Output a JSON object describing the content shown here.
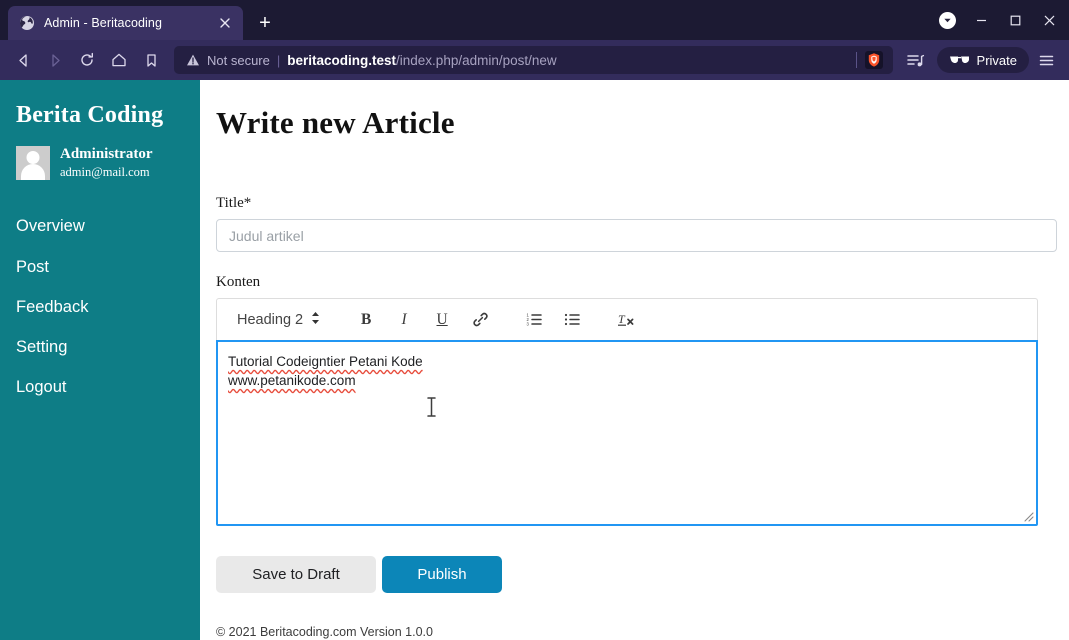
{
  "browser": {
    "tab": {
      "title": "Admin - Beritacoding",
      "favicon_icon": "globe-icon",
      "close_icon": "close-icon"
    },
    "new_tab_label": "+",
    "window_controls": {
      "brave_rewards_icon": "chevron-down-badge-icon",
      "minimize_label": "–",
      "maximize_label": "☐",
      "close_label": "×"
    },
    "nav": {
      "back_icon": "back-arrow-icon",
      "forward_icon": "forward-arrow-icon",
      "reload_icon": "reload-icon",
      "home_icon": "home-icon",
      "bookmark_icon": "bookmark-icon"
    },
    "address_bar": {
      "security_icon": "warning-triangle-icon",
      "security_label": "Not secure",
      "separator": "|",
      "url_host": "beritacoding.test",
      "url_path": "/index.php/admin/post/new",
      "shield_icon": "brave-shield-icon",
      "playlist_icon": "playlist-icon",
      "private_icon": "sunglasses-icon",
      "private_label": "Private",
      "menu_icon": "hamburger-menu-icon"
    },
    "colors": {
      "tabstrip_bg": "#1c1a33",
      "tab_active_bg": "#3a3263",
      "navbar_bg": "#332c5c",
      "urlbar_bg": "#241f42",
      "brave_orange": "#fb542b"
    }
  },
  "sidebar": {
    "brand": "Berita Coding",
    "user": {
      "avatar_icon": "user-avatar-icon",
      "name": "Administrator",
      "email": "admin@mail.com"
    },
    "items": [
      {
        "label": "Overview"
      },
      {
        "label": "Post"
      },
      {
        "label": "Feedback"
      },
      {
        "label": "Setting"
      },
      {
        "label": "Logout"
      }
    ],
    "bg_color": "#0e7d86"
  },
  "main": {
    "page_title": "Write new Article",
    "title_field": {
      "label": "Title*",
      "value": "",
      "placeholder": "Judul artikel"
    },
    "content_field": {
      "label": "Konten",
      "toolbar": {
        "heading_select": {
          "value": "Heading 2",
          "selector_icon": "updown-arrows-icon"
        },
        "buttons": [
          {
            "label": "B",
            "name": "bold-button"
          },
          {
            "label": "I",
            "name": "italic-button"
          },
          {
            "label": "U",
            "name": "underline-button"
          },
          {
            "label": "",
            "name": "link-icon"
          },
          {
            "label": "",
            "name": "ordered-list-icon"
          },
          {
            "label": "",
            "name": "unordered-list-icon"
          },
          {
            "label": "",
            "name": "clear-formatting-icon"
          }
        ]
      },
      "lines": [
        "Tutorial Codeigntier Petani Kode",
        "www.petanikode.com"
      ],
      "focus_border_color": "#2196f3",
      "resize_handle_icon": "resize-handle-icon",
      "text_cursor_icon": "text-caret-icon"
    },
    "buttons": {
      "save_draft": "Save to Draft",
      "publish": "Publish",
      "publish_color": "#0c86b8",
      "draft_color": "#e9e9e9"
    },
    "footer": "© 2021 Beritacoding.com Version 1.0.0"
  }
}
